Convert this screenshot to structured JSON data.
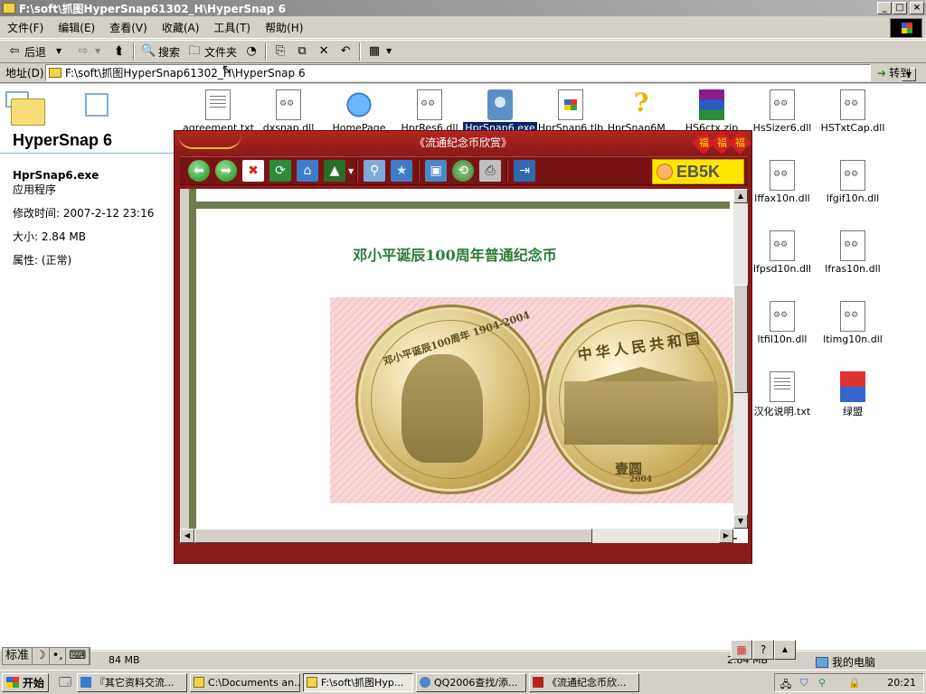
{
  "window": {
    "title": "F:\\soft\\抓图HyperSnap61302_H\\HyperSnap 6",
    "min": "_",
    "max": "□",
    "close": "×"
  },
  "menu": [
    "文件(F)",
    "编辑(E)",
    "查看(V)",
    "收藏(A)",
    "工具(T)",
    "帮助(H)"
  ],
  "toolbar": {
    "back": "后退",
    "search": "搜索",
    "folders": "文件夹"
  },
  "address": {
    "label": "地址(D)",
    "value": "F:\\soft\\抓图HyperSnap61302_H\\HyperSnap 6",
    "go": "转到"
  },
  "leftpane": {
    "folder_title": "HyperSnap 6",
    "file_name": "HprSnap6.exe",
    "file_type": "应用程序",
    "modified": "修改时间: 2007-2-12 23:16",
    "size": "大小: 2.84 MB",
    "attrs": "属性: (正常)"
  },
  "files": [
    {
      "name": "agreement.txt",
      "icon": "txt"
    },
    {
      "name": "dxsnap.dll",
      "icon": "dll"
    },
    {
      "name": "HomePage",
      "icon": "web"
    },
    {
      "name": "HprRes6.dll",
      "icon": "dll"
    },
    {
      "name": "HprSnap6.exe",
      "icon": "exe"
    },
    {
      "name": "HprSnap6.tlb",
      "icon": "tlb"
    },
    {
      "name": "HprSnap6M...",
      "icon": "help"
    },
    {
      "name": "HS6ctx.zip",
      "icon": "zip"
    },
    {
      "name": "HsSizer6.dll",
      "icon": "dll"
    },
    {
      "name": "HSTxtCap.dll",
      "icon": "dll"
    },
    {
      "name": "lffax10n.dll",
      "icon": "dll"
    },
    {
      "name": "lfgif10n.dll",
      "icon": "dll"
    },
    {
      "name": "lfpsd10n.dll",
      "icon": "dll"
    },
    {
      "name": "lfras10n.dll",
      "icon": "dll"
    },
    {
      "name": "ltfil10n.dll",
      "icon": "dll"
    },
    {
      "name": "ltimg10n.dll",
      "icon": "dll"
    },
    {
      "name": "汉化说明.txt",
      "icon": "txt"
    },
    {
      "name": "绿盟",
      "icon": "lnk"
    }
  ],
  "viewer": {
    "title": "《流通纪念币欣赏》",
    "fu": [
      "福",
      "福",
      "福"
    ],
    "logo": "EB5K",
    "heading": "邓小平诞辰100周年普通纪念币",
    "coin_obverse_text": "邓小平诞辰100周年 1904-2004",
    "coin_reverse_text": "中华人民共和国",
    "coin_reverse_value": "壹圆",
    "coin_reverse_year": "2004"
  },
  "status": {
    "left": "84 MB",
    "right": "2.84 MB",
    "location": "我的电脑"
  },
  "ime": [
    "标准",
    "☽",
    "•,",
    "⌨"
  ],
  "taskbar": {
    "start": "开始",
    "tasks": [
      "『其它资料交流...",
      "C:\\Documents an...",
      "F:\\soft\\抓图Hyp...",
      "QQ2006查找/添...",
      "《流通纪念币欣..."
    ],
    "clock": "20:21"
  }
}
